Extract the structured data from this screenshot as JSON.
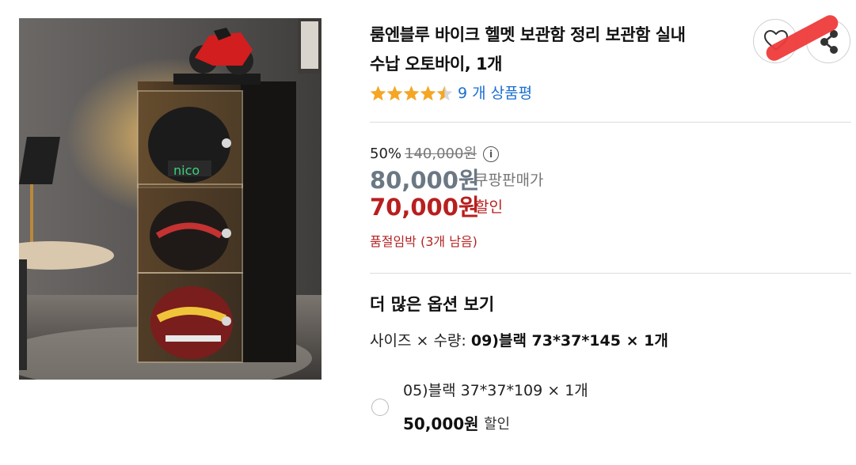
{
  "product": {
    "title_line1": "룸엔블루 바이크 헬멧 보관함 정리 보관함 실내",
    "title_line2": "수납 오토바이, 1개",
    "image_icon": "product-photo-helmet-storage-cabinet"
  },
  "actions": {
    "wishlist_icon": "heart-icon",
    "share_icon": "share-icon"
  },
  "rating": {
    "stars": 4.5,
    "max_stars": 5,
    "review_text": "9 개 상품평"
  },
  "price": {
    "discount_rate": "50%",
    "original_price": "140,000원",
    "main_price": "80,000원",
    "main_price_label": "쿠팡판매가",
    "sale_price": "70,000원",
    "sale_price_label": "할인"
  },
  "stock": {
    "text": "품절임박 (3개 남음)"
  },
  "options": {
    "heading": "더 많은 옵션 보기",
    "selected_label": "사이즈 × 수량: ",
    "selected_value": "09)블랙 73*37*145 × 1개",
    "items": [
      {
        "name": "05)블랙 37*37*109 × 1개",
        "price": "50,000원",
        "price_label": "할인"
      }
    ]
  },
  "colors": {
    "sale_red": "#b81f1f",
    "main_price_gray": "#6b7884",
    "link_blue": "#1a6fd1",
    "star_orange": "#f5a623"
  }
}
